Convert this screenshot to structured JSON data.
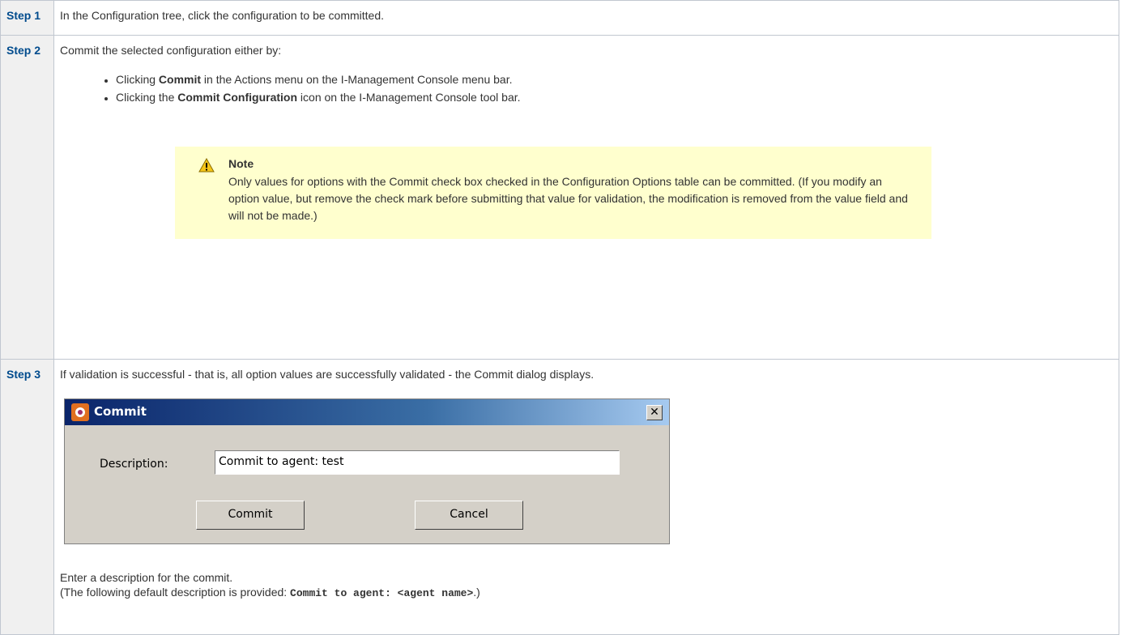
{
  "steps": [
    {
      "label": "Step 1",
      "text": "In the Configuration tree, click the configuration to be committed."
    },
    {
      "label": "Step 2",
      "intro": "Commit the selected configuration either by:",
      "bullets": [
        {
          "pre": "Clicking ",
          "bold": "Commit",
          "post": " in the Actions menu on the I-Management Console menu bar."
        },
        {
          "pre": "Clicking the ",
          "bold": "Commit Configuration",
          "post": " icon on the I-Management Console tool bar."
        }
      ],
      "note": {
        "icon": "warning-icon",
        "title": "Note",
        "text": "Only values for options with the Commit check box checked in the Configuration Options table can be committed. (If you modify an option value, but remove the check mark before submitting that value for validation, the modification is removed from the value field and will not be made.)"
      }
    },
    {
      "label": "Step 3",
      "text": "If validation is successful - that is, all option values are successfully validated - the Commit dialog displays.",
      "dialog": {
        "title": "Commit",
        "close_glyph": "✕",
        "description_label": "Description:",
        "description_value": "Commit to agent: test",
        "commit_label": "Commit",
        "cancel_label": "Cancel"
      },
      "after_line1": "Enter a description for the commit.",
      "after_line2_pre": "(The following default description is provided: ",
      "after_line2_code": "Commit to agent: <agent name>",
      "after_line2_post": ".)"
    }
  ]
}
